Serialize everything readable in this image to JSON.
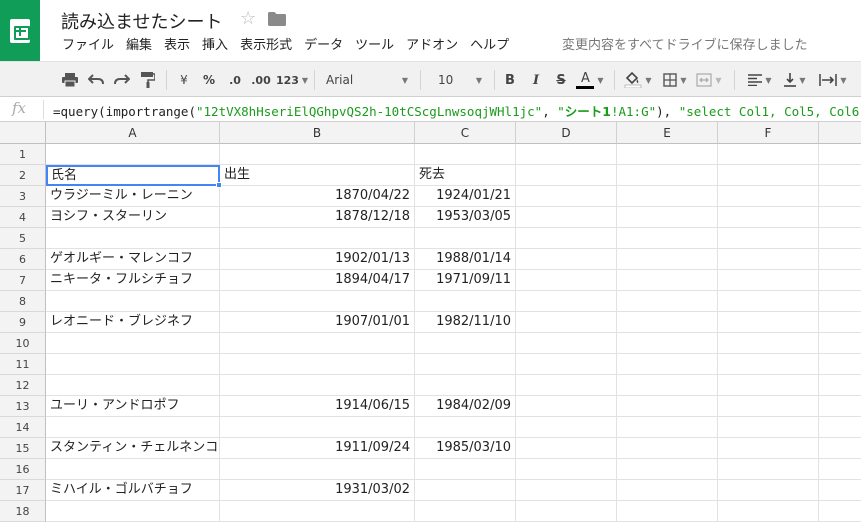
{
  "app": {
    "doc_title": "読み込ませたシート",
    "save_status": "変更内容をすべてドライブに保存しました"
  },
  "icons": {
    "logo": "google-sheets-logo",
    "star": "star-icon",
    "folder": "folder-icon"
  },
  "menu": [
    "ファイル",
    "編集",
    "表示",
    "挿入",
    "表示形式",
    "データ",
    "ツール",
    "アドオン",
    "ヘルプ"
  ],
  "toolbar": {
    "currency": "¥",
    "percent": "%",
    "dec_decrease": ".0",
    "dec_increase": ".00",
    "more_formats": "123",
    "font": "Arial",
    "font_size": "10",
    "bold": "B",
    "italic": "I",
    "strike": "S",
    "text_color": "A",
    "text_color_value": "#000000"
  },
  "formula_bar": {
    "fx": "fx",
    "prefix": "=query(importrange(",
    "key_string": "\"12tVX8hHseriElQGhpvQS2h-10tCScgLnwsoqjWHl1jc\"",
    "sep1": ", ",
    "range_open": "\"",
    "range_sheet": "シート1",
    "range_rest": "!A1:G\"",
    "mid": "), ",
    "select_string": "\"select Col1, Col5, Col6\"",
    "suffix": ")"
  },
  "grid": {
    "columns": [
      "A",
      "B",
      "C",
      "D",
      "E",
      "F"
    ],
    "rows": [
      "1",
      "2",
      "3",
      "4",
      "5",
      "6",
      "7",
      "8",
      "9",
      "10",
      "11",
      "12",
      "13",
      "14",
      "15",
      "16",
      "17",
      "18"
    ],
    "cells": [
      {
        "row": 2,
        "col": "A",
        "value": "氏名",
        "align": "left",
        "selected": true
      },
      {
        "row": 2,
        "col": "B",
        "value": "出生",
        "align": "left"
      },
      {
        "row": 2,
        "col": "C",
        "value": "死去",
        "align": "left"
      },
      {
        "row": 3,
        "col": "A",
        "value": "ウラジーミル・レーニン",
        "align": "left"
      },
      {
        "row": 3,
        "col": "B",
        "value": "1870/04/22",
        "align": "right"
      },
      {
        "row": 3,
        "col": "C",
        "value": "1924/01/21",
        "align": "right"
      },
      {
        "row": 4,
        "col": "A",
        "value": "ヨシフ・スターリン",
        "align": "left"
      },
      {
        "row": 4,
        "col": "B",
        "value": "1878/12/18",
        "align": "right"
      },
      {
        "row": 4,
        "col": "C",
        "value": "1953/03/05",
        "align": "right"
      },
      {
        "row": 6,
        "col": "A",
        "value": "ゲオルギー・マレンコフ",
        "align": "left"
      },
      {
        "row": 6,
        "col": "B",
        "value": "1902/01/13",
        "align": "right"
      },
      {
        "row": 6,
        "col": "C",
        "value": "1988/01/14",
        "align": "right"
      },
      {
        "row": 7,
        "col": "A",
        "value": "ニキータ・フルシチョフ",
        "align": "left"
      },
      {
        "row": 7,
        "col": "B",
        "value": "1894/04/17",
        "align": "right"
      },
      {
        "row": 7,
        "col": "C",
        "value": "1971/09/11",
        "align": "right"
      },
      {
        "row": 9,
        "col": "A",
        "value": "レオニード・ブレジネフ",
        "align": "left"
      },
      {
        "row": 9,
        "col": "B",
        "value": "1907/01/01",
        "align": "right"
      },
      {
        "row": 9,
        "col": "C",
        "value": "1982/11/10",
        "align": "right"
      },
      {
        "row": 13,
        "col": "A",
        "value": "ユーリ・アンドロポフ",
        "align": "left"
      },
      {
        "row": 13,
        "col": "B",
        "value": "1914/06/15",
        "align": "right"
      },
      {
        "row": 13,
        "col": "C",
        "value": "1984/02/09",
        "align": "right"
      },
      {
        "row": 15,
        "col": "A",
        "value": "スタンティン・チェルネンコ",
        "align": "left"
      },
      {
        "row": 15,
        "col": "B",
        "value": "1911/09/24",
        "align": "right"
      },
      {
        "row": 15,
        "col": "C",
        "value": "1985/03/10",
        "align": "right"
      },
      {
        "row": 17,
        "col": "A",
        "value": "ミハイル・ゴルバチョフ",
        "align": "left"
      },
      {
        "row": 17,
        "col": "B",
        "value": "1931/03/02",
        "align": "right"
      }
    ]
  },
  "colors": {
    "brand_green": "#0f9d58",
    "selection_blue": "#4285f4",
    "formula_string_green": "#1a9c1a"
  }
}
